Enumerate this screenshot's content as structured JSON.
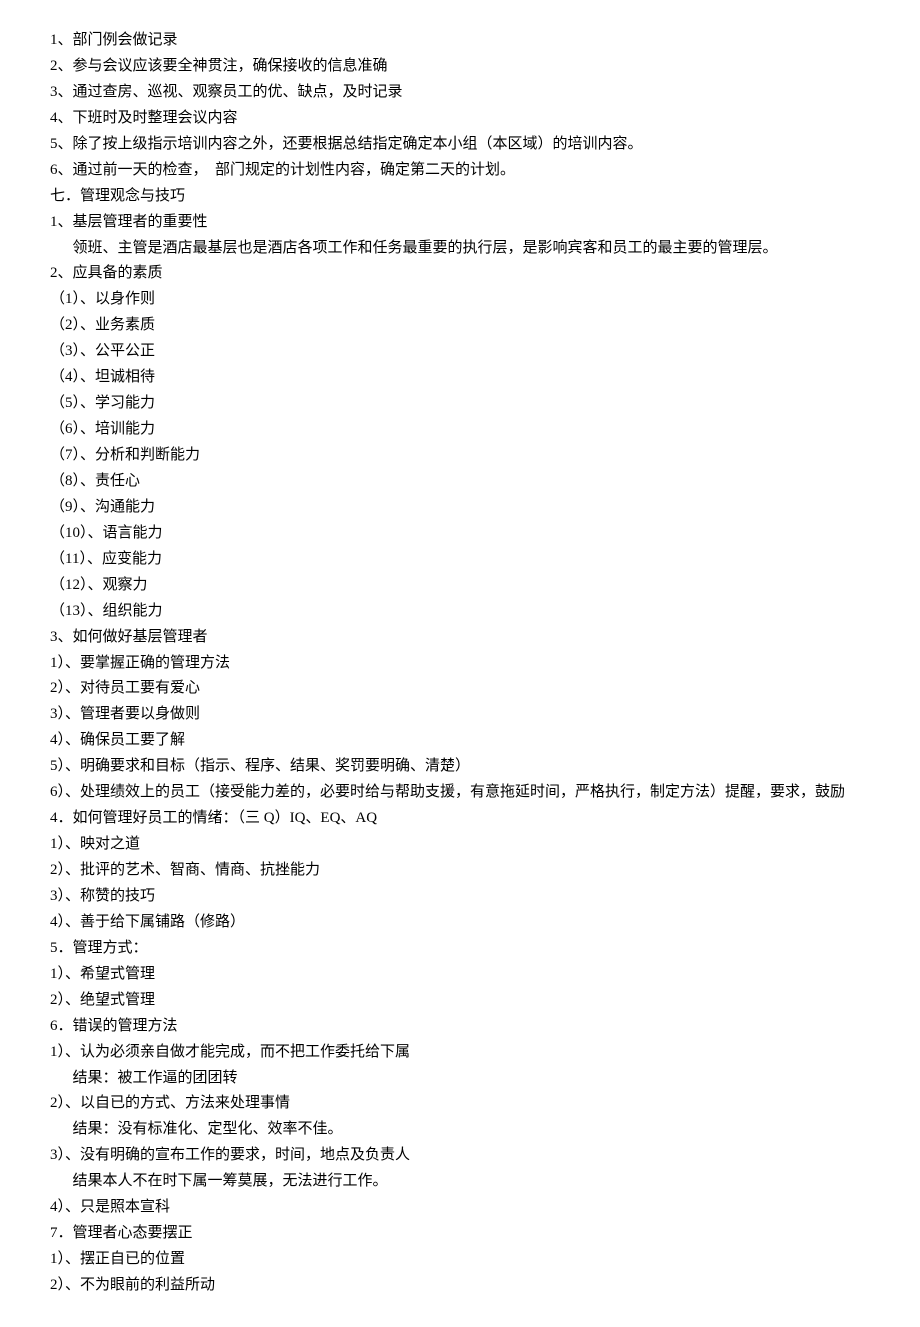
{
  "lines": [
    {
      "text": "1、部门例会做记录",
      "indent": 0
    },
    {
      "text": "2、参与会议应该要全神贯注，确保接收的信息准确",
      "indent": 0
    },
    {
      "text": "3、通过查房、巡视、观察员工的优、缺点，及时记录",
      "indent": 0
    },
    {
      "text": "4、下班时及时整理会议内容",
      "indent": 0
    },
    {
      "text": "5、除了按上级指示培训内容之外，还要根据总结指定确定本小组（本区域）的培训内容。",
      "indent": 0
    },
    {
      "text": "6、通过前一天的检查，  部门规定的计划性内容，确定第二天的计划。",
      "indent": 0
    },
    {
      "text": "七．管理观念与技巧",
      "indent": 0
    },
    {
      "text": "1、基层管理者的重要性",
      "indent": 0
    },
    {
      "text": "领班、主管是酒店最基层也是酒店各项工作和任务最重要的执行层，是影响宾客和员工的最主要的管理层。",
      "indent": 1
    },
    {
      "text": "2、应具备的素质",
      "indent": 0
    },
    {
      "text": "（1）、以身作则",
      "indent": 0
    },
    {
      "text": "（2）、业务素质",
      "indent": 0
    },
    {
      "text": "（3）、公平公正",
      "indent": 0
    },
    {
      "text": "（4）、坦诚相待",
      "indent": 0
    },
    {
      "text": "（5）、学习能力",
      "indent": 0
    },
    {
      "text": "（6）、培训能力",
      "indent": 0
    },
    {
      "text": "（7）、分析和判断能力",
      "indent": 0
    },
    {
      "text": "（8）、责任心",
      "indent": 0
    },
    {
      "text": "（9）、沟通能力",
      "indent": 0
    },
    {
      "text": "（10）、语言能力",
      "indent": 0
    },
    {
      "text": "（11）、应变能力",
      "indent": 0
    },
    {
      "text": "（12）、观察力",
      "indent": 0
    },
    {
      "text": "（13）、组织能力",
      "indent": 0
    },
    {
      "text": "3、如何做好基层管理者",
      "indent": 0
    },
    {
      "text": "1）、要掌握正确的管理方法",
      "indent": 0
    },
    {
      "text": "2）、对待员工要有爱心",
      "indent": 0
    },
    {
      "text": "3）、管理者要以身做则",
      "indent": 0
    },
    {
      "text": "4）、确保员工要了解",
      "indent": 0
    },
    {
      "text": "5）、明确要求和目标（指示、程序、结果、奖罚要明确、清楚）",
      "indent": 0
    },
    {
      "text": "6）、处理绩效上的员工（接受能力差的，必要时给与帮助支援，有意拖延时间，严格执行，制定方法）提醒，要求，鼓励",
      "indent": 0
    },
    {
      "text": "4．如何管理好员工的情绪：（三 Q）IQ、EQ、AQ",
      "indent": 0
    },
    {
      "text": "1）、映对之道",
      "indent": 0
    },
    {
      "text": "2）、批评的艺术、智商、情商、抗挫能力",
      "indent": 0
    },
    {
      "text": "3）、称赞的技巧",
      "indent": 0
    },
    {
      "text": "4）、善于给下属铺路（修路）",
      "indent": 0
    },
    {
      "text": "5．管理方式：",
      "indent": 0
    },
    {
      "text": "1）、希望式管理",
      "indent": 0
    },
    {
      "text": "2）、绝望式管理",
      "indent": 0
    },
    {
      "text": "6．错误的管理方法",
      "indent": 0
    },
    {
      "text": "1）、认为必须亲自做才能完成，而不把工作委托给下属",
      "indent": 0
    },
    {
      "text": "结果：被工作逼的团团转",
      "indent": 1
    },
    {
      "text": "2）、以自已的方式、方法来处理事情",
      "indent": 0
    },
    {
      "text": "结果：没有标准化、定型化、效率不佳。",
      "indent": 1
    },
    {
      "text": "3）、没有明确的宣布工作的要求，时间，地点及负责人",
      "indent": 0
    },
    {
      "text": "结果本人不在时下属一筹莫展，无法进行工作。",
      "indent": 1
    },
    {
      "text": "4）、只是照本宣科",
      "indent": 0
    },
    {
      "text": "7．管理者心态要摆正",
      "indent": 0
    },
    {
      "text": "1）、摆正自已的位置",
      "indent": 0
    },
    {
      "text": "2）、不为眼前的利益所动",
      "indent": 0
    }
  ]
}
